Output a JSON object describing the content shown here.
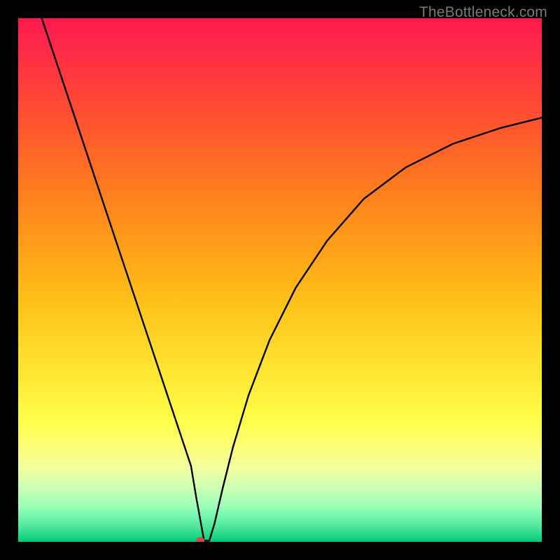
{
  "watermark": "TheBottleneck.com",
  "chart_data": {
    "type": "line",
    "title": "",
    "xlabel": "",
    "ylabel": "",
    "xlim": [
      0,
      100
    ],
    "ylim": [
      0,
      100
    ],
    "note": "Axes are unlabeled; x and y are expressed as 0–100 percent of the plot area. The curve (black) drops steeply from the top-left to a minimum near x≈34, then rises with diminishing slope toward the right edge. A single red marker sits at the minimum.",
    "series": [
      {
        "name": "curve",
        "x": [
          4.5,
          8,
          12,
          16,
          20,
          24,
          28,
          31,
          33,
          34,
          35.5,
          36.5,
          37.5,
          39,
          41,
          44,
          48,
          53,
          59,
          66,
          74,
          83,
          92,
          100
        ],
        "y": [
          100,
          89.5,
          77.5,
          65.5,
          53.5,
          41.5,
          29.5,
          20.5,
          14.5,
          8.5,
          0.2,
          0.2,
          3.5,
          10,
          18,
          28,
          38.5,
          48.5,
          57.5,
          65.5,
          71.5,
          76,
          79,
          81
        ]
      }
    ],
    "marker": {
      "x": 34.8,
      "y": 0.3,
      "color": "#c94d42",
      "rx": 6,
      "ry": 4.5
    },
    "colors": {
      "curve": "#000000",
      "background_top": "#ff1a50",
      "background_bottom": "#06c873",
      "frame": "#000000"
    }
  }
}
